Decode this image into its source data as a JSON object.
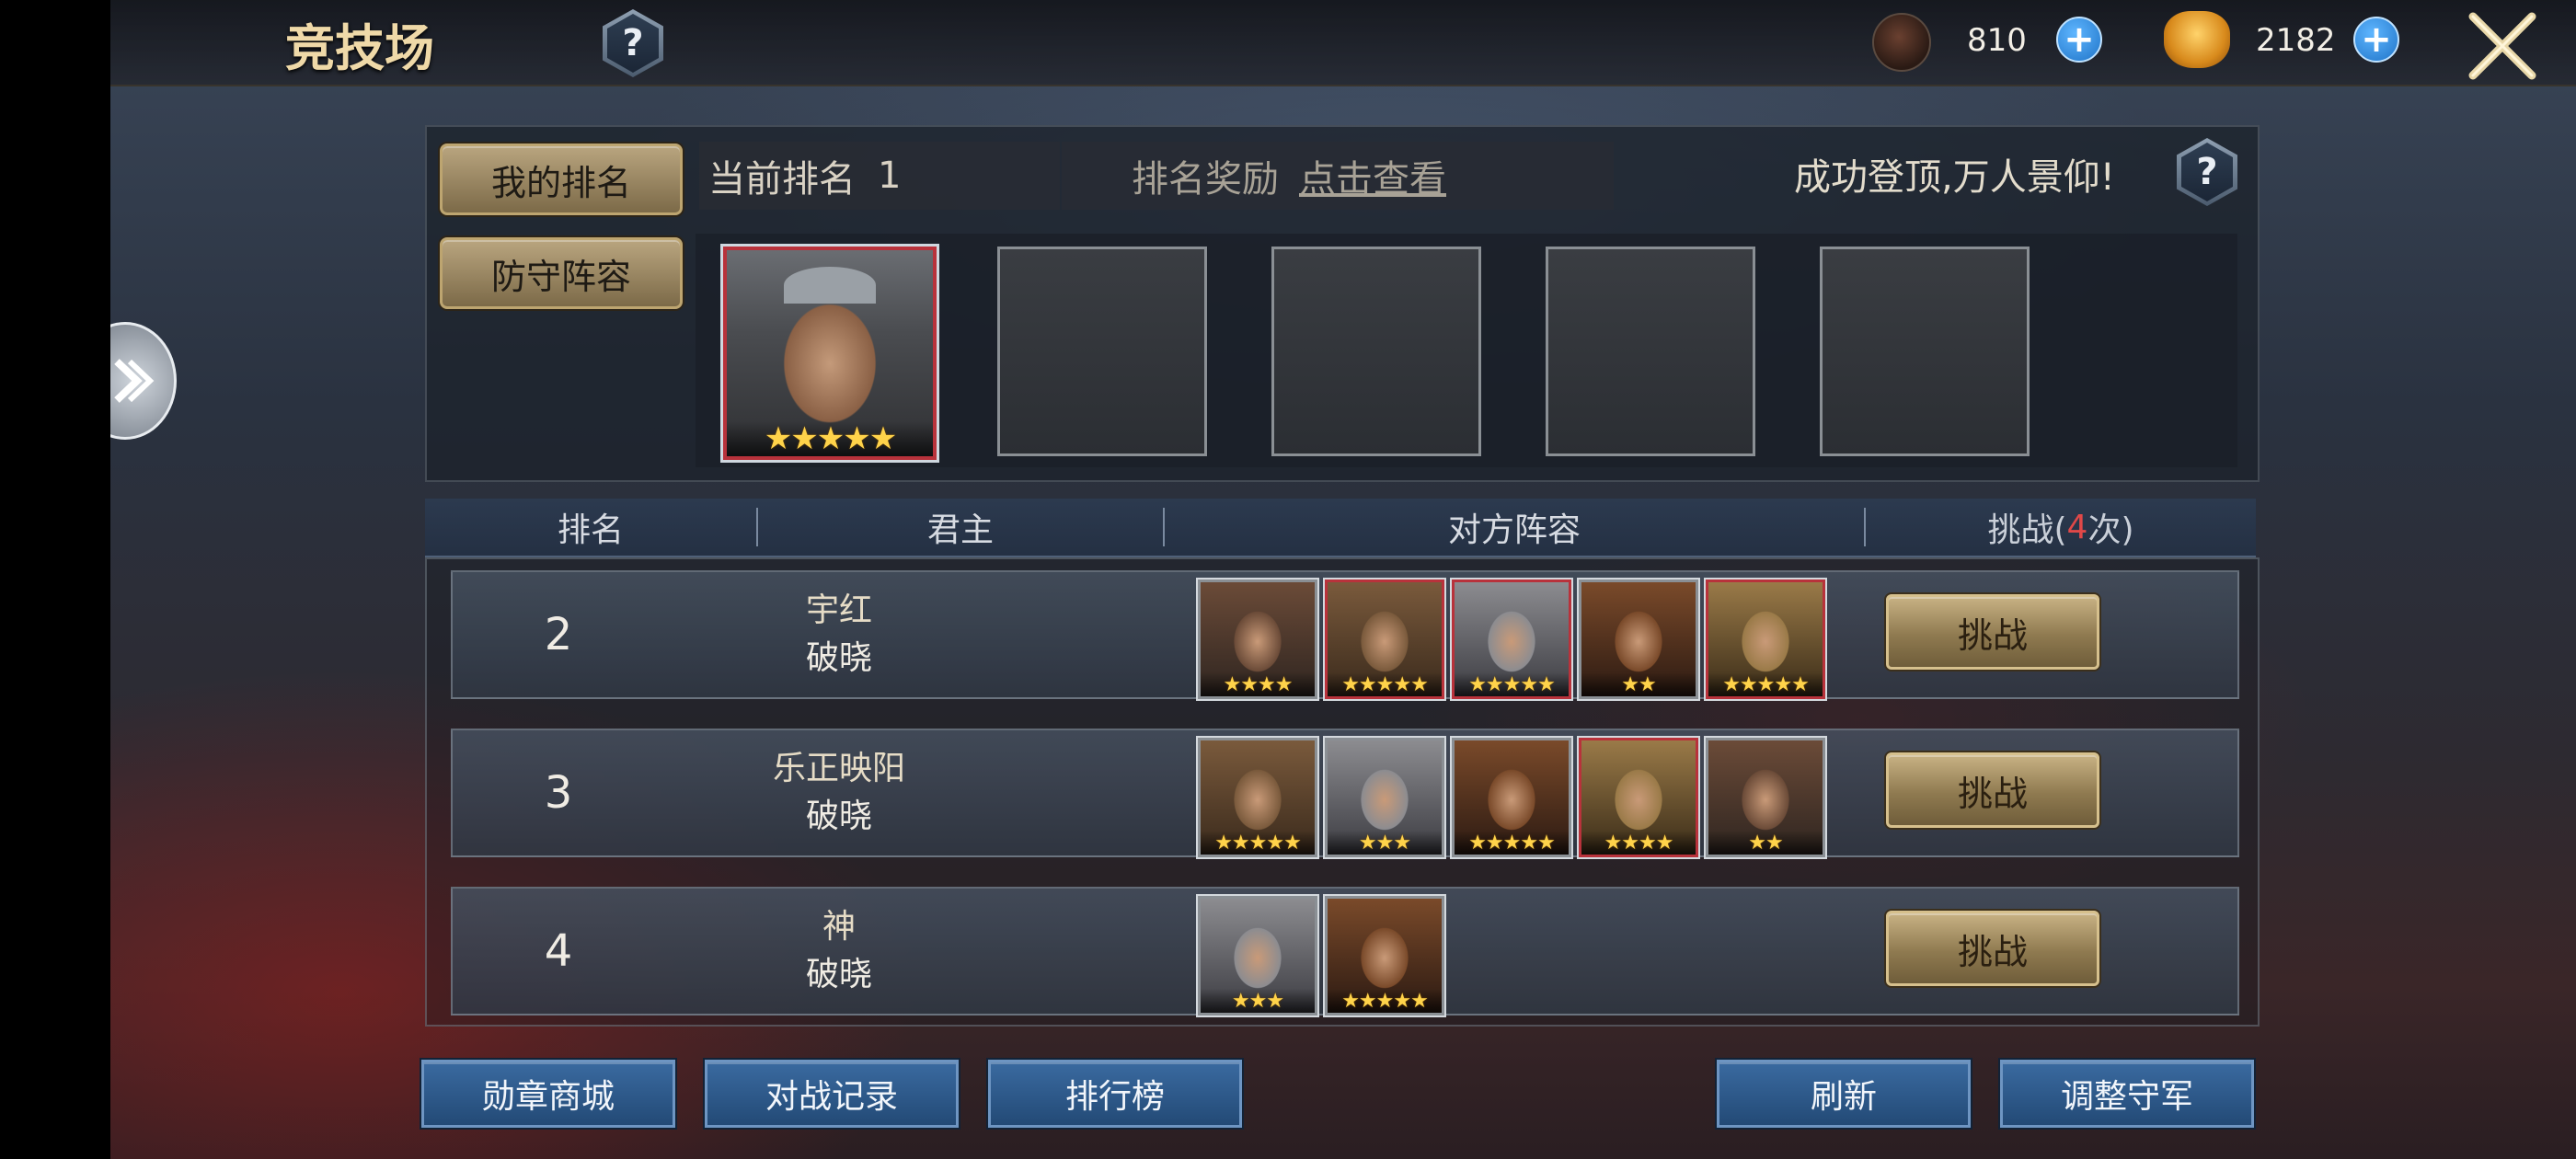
{
  "header": {
    "title": "竞技场",
    "resources": [
      {
        "icon": "medal-icon",
        "value": "810"
      },
      {
        "icon": "gold-ingot-icon",
        "value": "2182"
      }
    ]
  },
  "rank_panel": {
    "my_rank_tab": "我的排名",
    "defense_tab": "防守阵容",
    "current_rank_label": "当前排名",
    "current_rank_value": "1",
    "reward_label": "排名奖励",
    "reward_link": "点击查看",
    "top_message": "成功登顶,万人景仰!",
    "defense_hero_stars": "★★★★★"
  },
  "table": {
    "headers": {
      "rank": "排名",
      "lord": "君主",
      "lineup": "对方阵容",
      "challenge_prefix": "挑战(",
      "challenge_count": "4",
      "challenge_suffix": "次)"
    },
    "rows": [
      {
        "rank": "2",
        "name": "宇红",
        "server": "破晓",
        "button": "挑战",
        "heroes": [
          {
            "stars": "★★★★",
            "frame": "silver"
          },
          {
            "stars": "★★★★★",
            "frame": "red"
          },
          {
            "stars": "★★★★★",
            "frame": "red"
          },
          {
            "stars": "★★",
            "frame": "silver"
          },
          {
            "stars": "★★★★★",
            "frame": "red"
          }
        ]
      },
      {
        "rank": "3",
        "name": "乐正映阳",
        "server": "破晓",
        "button": "挑战",
        "heroes": [
          {
            "stars": "★★★★★",
            "frame": "silver"
          },
          {
            "stars": "★★★",
            "frame": "silver"
          },
          {
            "stars": "★★★★★",
            "frame": "silver"
          },
          {
            "stars": "★★★★",
            "frame": "red"
          },
          {
            "stars": "★★",
            "frame": "silver"
          }
        ]
      },
      {
        "rank": "4",
        "name": "神",
        "server": "破晓",
        "button": "挑战",
        "heroes": [
          {
            "stars": "★★★",
            "frame": "silver"
          },
          {
            "stars": "★★★★★",
            "frame": "silver"
          }
        ]
      }
    ]
  },
  "bottom_buttons": {
    "medal_shop": "勋章商城",
    "battle_log": "对战记录",
    "leaderboard": "排行榜",
    "refresh": "刷新",
    "adjust_defense": "调整守军"
  },
  "colors": {
    "accent_gold": "#c8b284",
    "challenge_count": "#e04848",
    "blue_button": "#2f5e92"
  }
}
